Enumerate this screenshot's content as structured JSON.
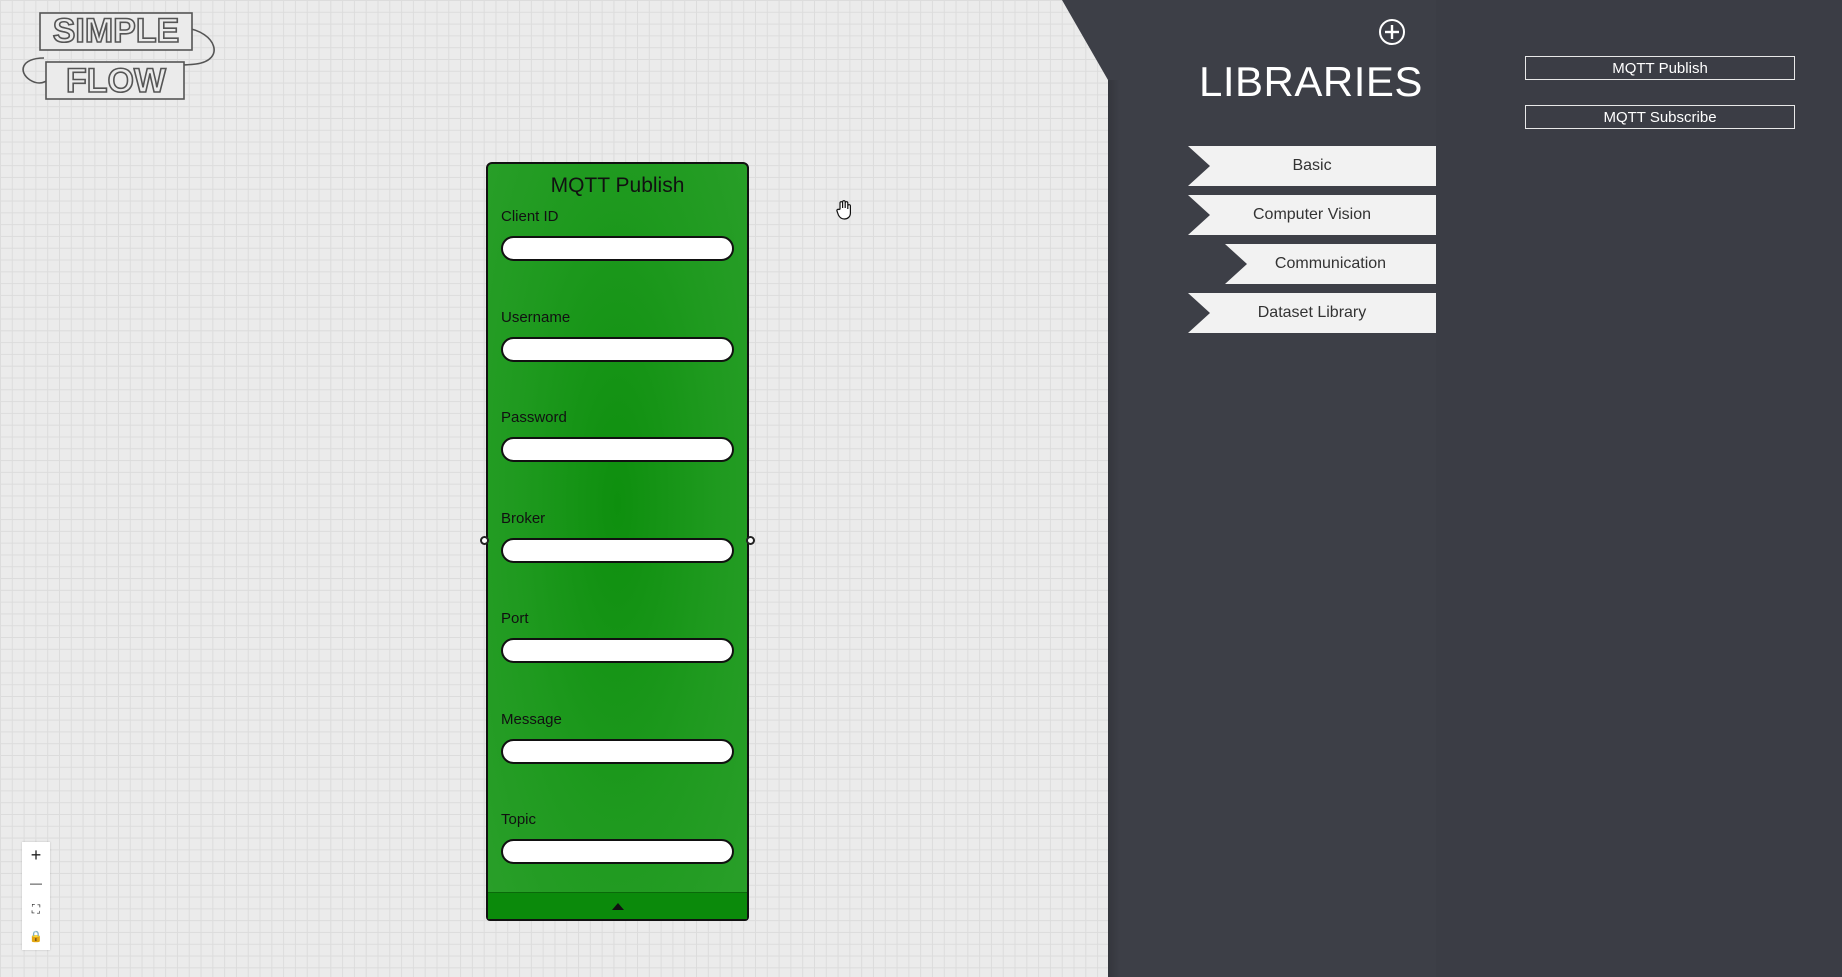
{
  "logo": {
    "line1": "SIMPLE",
    "line2": "FLOW"
  },
  "node": {
    "title": "MQTT Publish",
    "fields": [
      {
        "label": "Client ID",
        "value": ""
      },
      {
        "label": "Username",
        "value": ""
      },
      {
        "label": "Password",
        "value": ""
      },
      {
        "label": "Broker",
        "value": ""
      },
      {
        "label": "Port",
        "value": ""
      },
      {
        "label": "Message",
        "value": ""
      },
      {
        "label": "Topic",
        "value": ""
      }
    ],
    "color": "#1c961c"
  },
  "zoom_controls": [
    "+",
    "—",
    "⛶",
    "🔒"
  ],
  "libraries": {
    "title": "LIBRARIES",
    "categories": [
      "Basic",
      "Computer Vision",
      "Communication",
      "Dataset Library"
    ],
    "selected_category": "Communication",
    "items": [
      "MQTT Publish",
      "MQTT Subscribe"
    ]
  },
  "colors": {
    "panel": "#3d3f47",
    "canvas": "#ebebeb",
    "tab": "#f2f2f2"
  }
}
